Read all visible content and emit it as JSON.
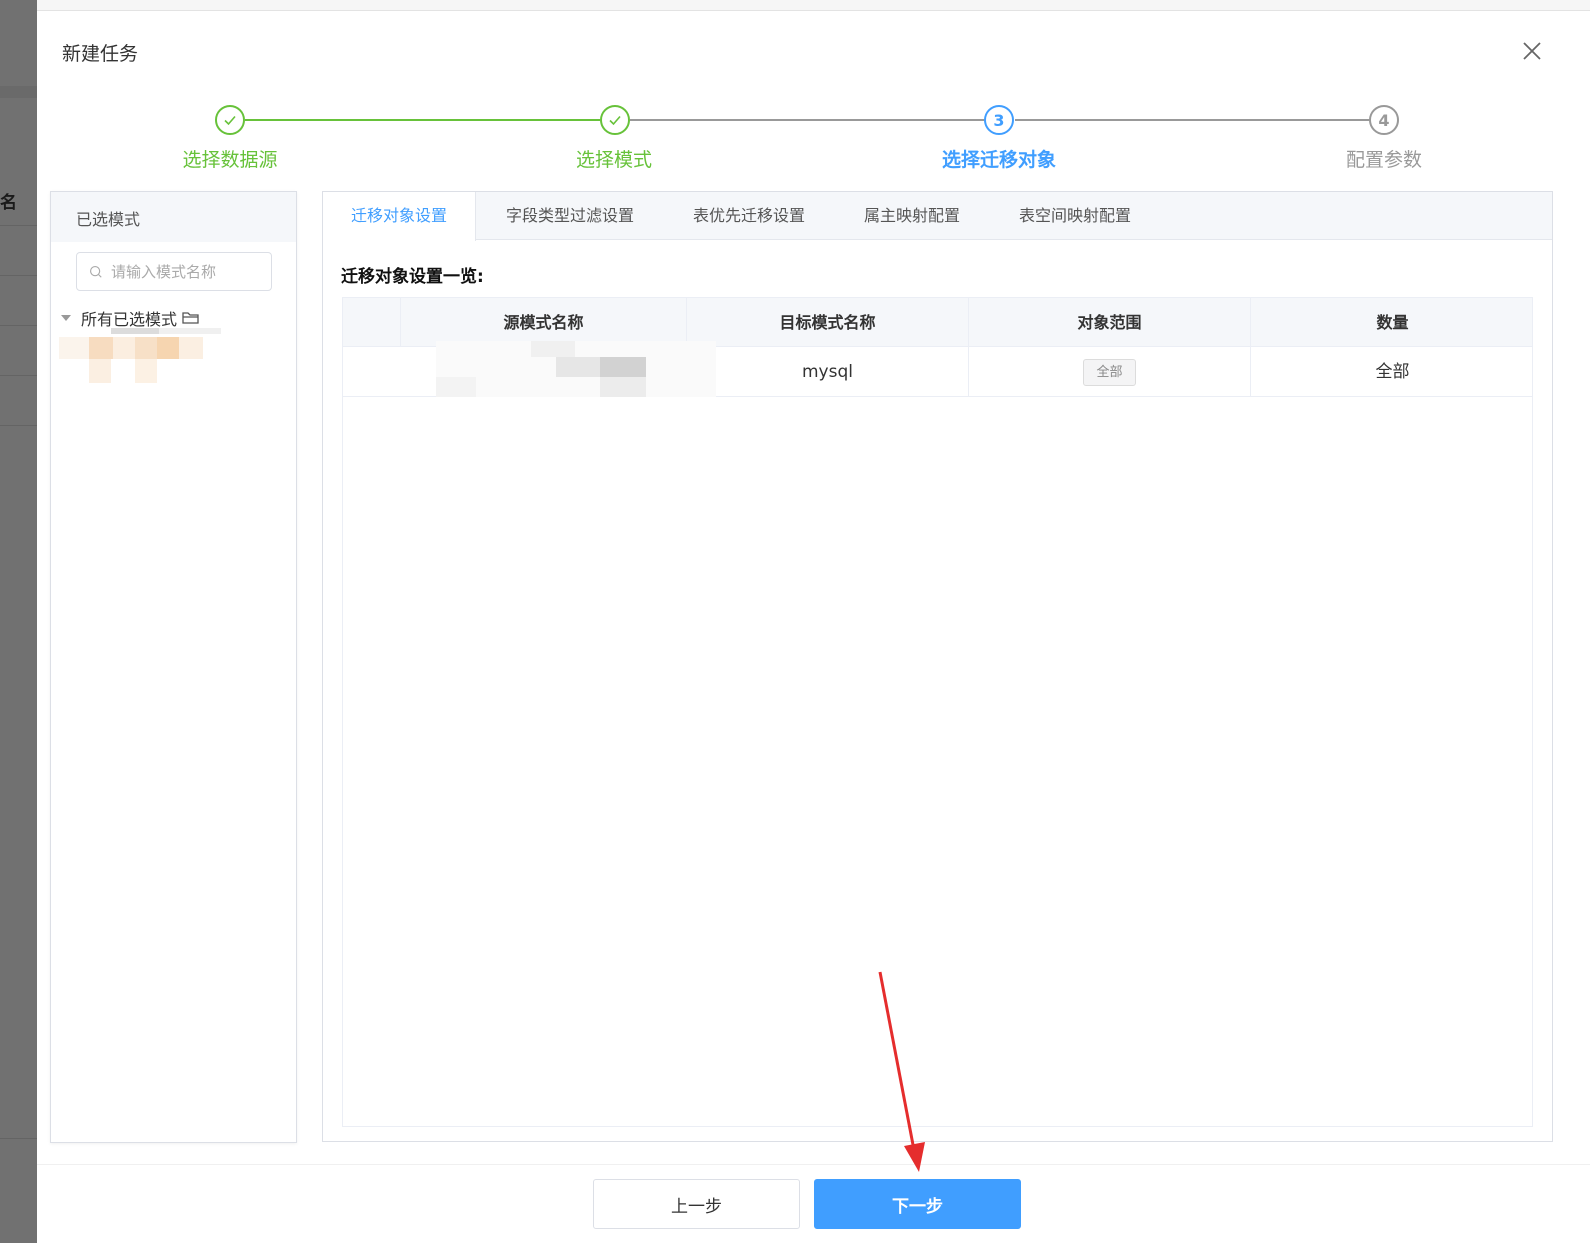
{
  "dialog": {
    "title": "新建任务"
  },
  "steps": [
    {
      "label": "选择数据源",
      "status": "finished",
      "number": "1"
    },
    {
      "label": "选择模式",
      "status": "finished",
      "number": "2"
    },
    {
      "label": "选择迁移对象",
      "status": "active",
      "number": "3"
    },
    {
      "label": "配置参数",
      "status": "pending",
      "number": "4"
    }
  ],
  "left_panel": {
    "header": "已选模式",
    "search_placeholder": "请输入模式名称",
    "tree_root": "所有已选模式"
  },
  "tabs": [
    {
      "label": "迁移对象设置",
      "active": true
    },
    {
      "label": "字段类型过滤设置",
      "active": false
    },
    {
      "label": "表优先迁移设置",
      "active": false
    },
    {
      "label": "属主映射配置",
      "active": false
    },
    {
      "label": "表空间映射配置",
      "active": false
    }
  ],
  "section_title": "迁移对象设置一览:",
  "table": {
    "columns": [
      "",
      "源模式名称",
      "目标模式名称",
      "对象范围",
      "数量"
    ],
    "rows": [
      {
        "select": "",
        "source": "",
        "target": "mysql",
        "scope": "全部",
        "count": "全部"
      }
    ]
  },
  "footer": {
    "prev_label": "上一步",
    "next_label": "下一步"
  },
  "backdrop": {
    "char": "名"
  },
  "colors": {
    "primary": "#409eff",
    "success": "#67c23a",
    "pending": "#999999",
    "annotation_arrow": "#e52d2d"
  }
}
